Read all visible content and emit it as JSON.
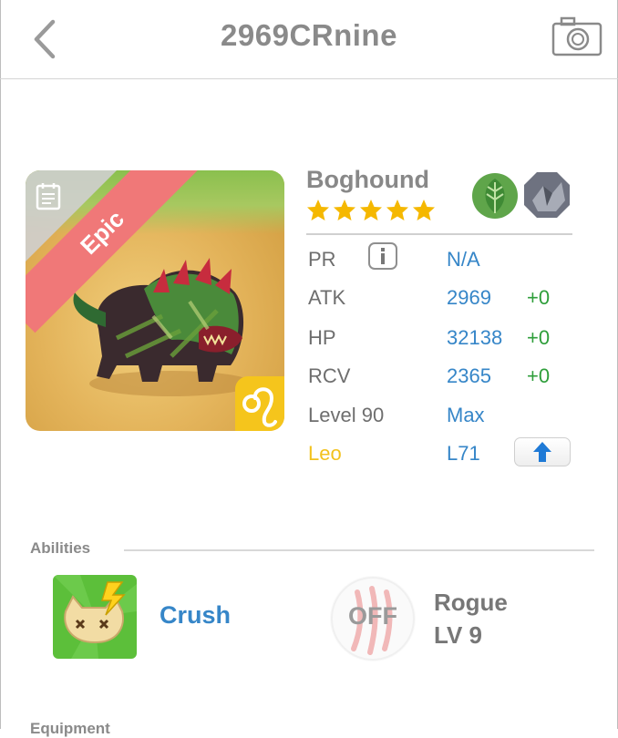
{
  "header": {
    "title": "2969CRnine"
  },
  "monster": {
    "name": "Boghound",
    "rarity": "Epic",
    "stars": 5,
    "element": "nature",
    "type": "rock",
    "zodiac_symbol": "♌"
  },
  "stats": {
    "pr": {
      "label": "PR",
      "value": "N/A"
    },
    "atk": {
      "label": "ATK",
      "value": "2969",
      "bonus": "+0"
    },
    "hp": {
      "label": "HP",
      "value": "32138",
      "bonus": "+0"
    },
    "rcv": {
      "label": "RCV",
      "value": "2365",
      "bonus": "+0"
    },
    "level": {
      "label": "Level 90",
      "value": "Max"
    },
    "sign": {
      "label": "Leo",
      "value": "L71"
    }
  },
  "abilities": {
    "section_label": "Abilities",
    "ability_name": "Crush",
    "skill_state": "OFF",
    "skill_name": "Rogue",
    "skill_level": "LV 9"
  },
  "next_section": {
    "label": "Equipment"
  },
  "icons": {
    "back": "chevron-left-icon",
    "camera": "camera-icon",
    "memo": "memo-icon",
    "info": "info-icon",
    "upgrade": "arrow-up-icon",
    "element": "leaf-icon",
    "type": "rock-icon"
  },
  "colors": {
    "accent_blue": "#3686c8",
    "bonus_green": "#2e9e3a",
    "leo_yellow": "#f2c21e",
    "epic_red": "#f07878",
    "star_gold": "#f5b800"
  }
}
